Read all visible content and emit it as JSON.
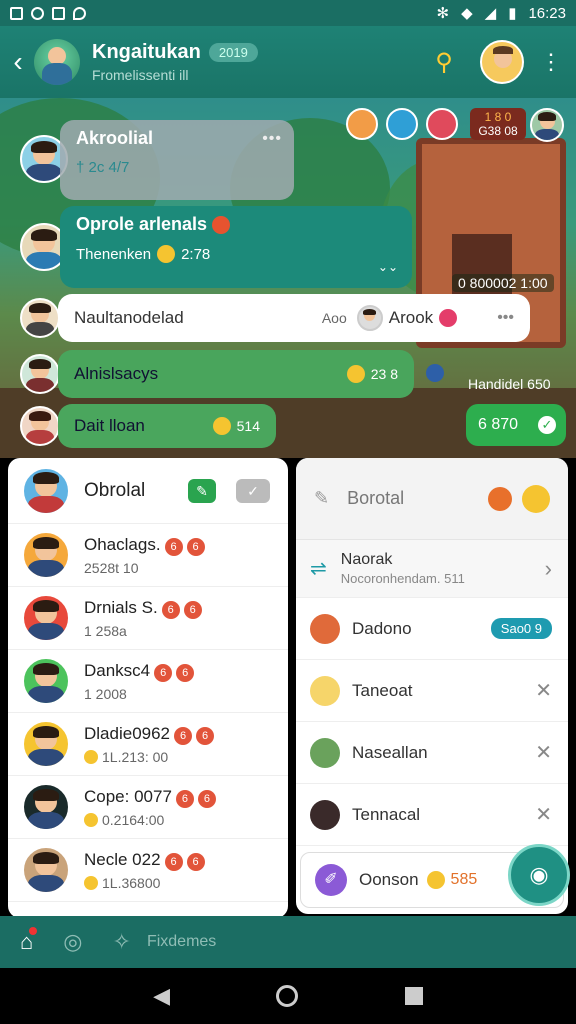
{
  "status_bar": {
    "time": "16:23"
  },
  "header": {
    "title": "Kngaitukan",
    "badge": "2019",
    "subtitle": "Fromelissenti ill"
  },
  "chat": {
    "top_right_badge_a": "1 8 0",
    "top_right_badge_b": "G38 08",
    "messages": [
      {
        "name": "Akroolial",
        "meta": "† 2c 4/7"
      },
      {
        "name": "Oprole arlenals",
        "meta_left": "Thenenken",
        "meta_right": "2:78"
      },
      {
        "name": "Naultanodelad",
        "meta_right": "Aoo",
        "reply": "Arook",
        "side_label": "0 800002 1:00"
      },
      {
        "name": "Alnislsacys",
        "meta": "23 8",
        "side_label": "Handidel 650"
      },
      {
        "name": "Dait lloan",
        "meta": "514",
        "green_pill": "6 870"
      }
    ]
  },
  "left_panel": {
    "title": "Obrolal",
    "items": [
      {
        "name": "Ohaclags.",
        "sub": "2528t 10"
      },
      {
        "name": "Drnials S.",
        "sub": "1  258a"
      },
      {
        "name": "Danksc4",
        "sub": "1  2008"
      },
      {
        "name": "Dladie0962",
        "sub": "1L.213: 00"
      },
      {
        "name": "Cope: 0077",
        "sub": "0.2164:00"
      },
      {
        "name": "Necle 022",
        "sub": "1L.36800"
      }
    ]
  },
  "right_panel": {
    "title": "Borotal",
    "nav_item": {
      "name": "Naorak",
      "sub": "Nocoronhendam. 511"
    },
    "items": [
      {
        "name": "Dadono",
        "badge": "Sao0 9"
      },
      {
        "name": "Taneoat"
      },
      {
        "name": "Naseallan"
      },
      {
        "name": "Tennacal"
      }
    ],
    "footer": {
      "name": "Oonson",
      "count": "585"
    }
  },
  "bottom_nav": {
    "label": "Fixdemes"
  }
}
